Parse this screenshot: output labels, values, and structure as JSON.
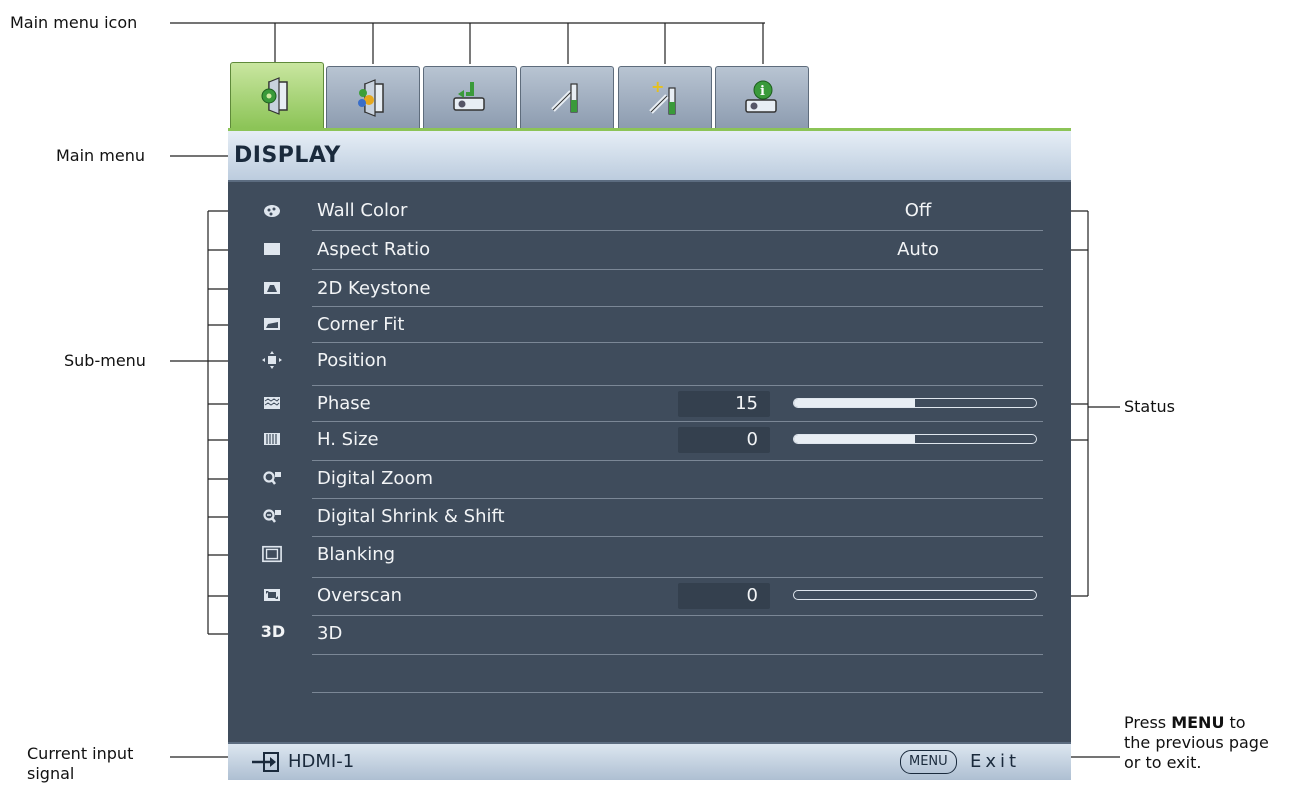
{
  "callouts": {
    "main_menu_icon": "Main menu icon",
    "main_menu": "Main menu",
    "sub_menu": "Sub-menu",
    "status": "Status",
    "current_input_line1": "Current input",
    "current_input_line2": "signal",
    "press_pre": "Press ",
    "press_key": "MENU",
    "press_post": " to",
    "press_line2": "the previous page",
    "press_line3": "or to exit."
  },
  "tabs": [
    {
      "icon": "display-settings-icon",
      "active": true
    },
    {
      "icon": "picture-icon",
      "active": false
    },
    {
      "icon": "source-projector-icon",
      "active": false
    },
    {
      "icon": "system-setup-basic-icon",
      "active": false
    },
    {
      "icon": "system-setup-advanced-icon",
      "active": false
    },
    {
      "icon": "information-icon",
      "active": false
    }
  ],
  "menu": {
    "title": "DISPLAY",
    "items": [
      {
        "label": "Wall Color",
        "icon": "palette-icon",
        "value": "Off"
      },
      {
        "label": "Aspect Ratio",
        "icon": "aspect-ratio-icon",
        "value": "Auto"
      },
      {
        "label": "2D Keystone",
        "icon": "keystone-icon"
      },
      {
        "label": "Corner Fit",
        "icon": "corner-fit-icon"
      },
      {
        "label": "Position",
        "icon": "position-icon"
      },
      {
        "label": "Phase",
        "icon": "phase-icon",
        "number": "15",
        "level": 0.5
      },
      {
        "label": "H. Size",
        "icon": "h-size-icon",
        "number": "0",
        "level": 0.5
      },
      {
        "label": "Digital Zoom",
        "icon": "digital-zoom-icon"
      },
      {
        "label": "Digital Shrink & Shift",
        "icon": "digital-shrink-icon"
      },
      {
        "label": "Blanking",
        "icon": "blanking-icon"
      },
      {
        "label": "Overscan",
        "icon": "overscan-icon",
        "number": "0",
        "level": 0.0
      },
      {
        "label": "3D",
        "icon": "3d-icon",
        "icon_text": "3D"
      }
    ]
  },
  "footer": {
    "input": "HDMI-1",
    "menu_key": "MENU",
    "exit": "Exit"
  }
}
